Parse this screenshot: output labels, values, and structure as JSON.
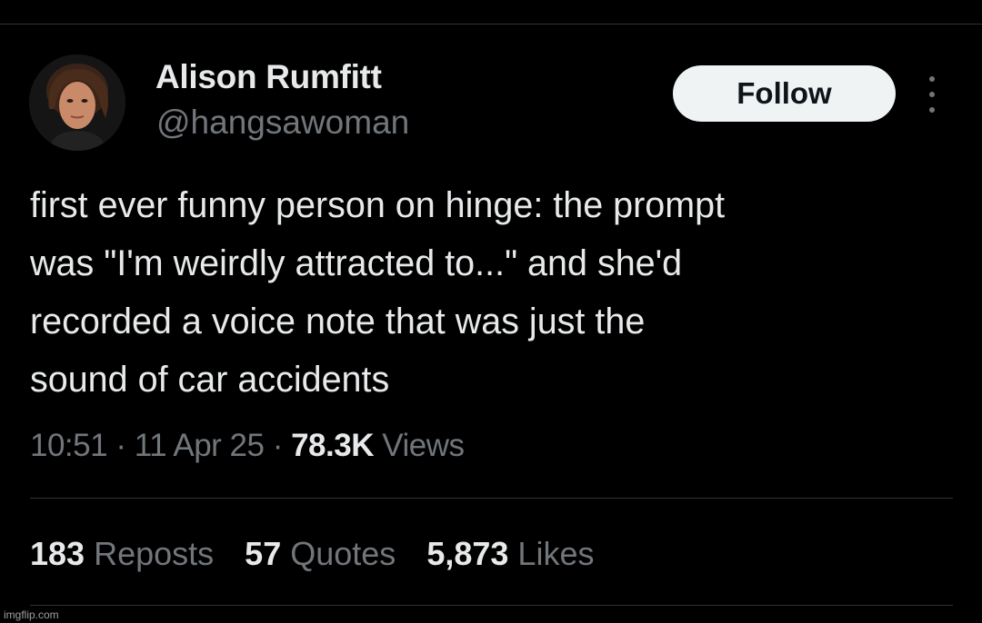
{
  "colors": {
    "background": "#000000",
    "primary_text": "#e7e9ea",
    "secondary_text": "#71767b",
    "divider": "#2f3336",
    "follow_button_bg": "#eff3f4",
    "follow_button_text": "#0f1419"
  },
  "author": {
    "display_name": "Alison Rumfitt",
    "handle": "@hangsawoman",
    "avatar": "profile-photo"
  },
  "follow_button": {
    "label": "Follow"
  },
  "more_menu": {
    "icon": "more-vertical-icon"
  },
  "tweet": {
    "lines": [
      "first ever funny person on hinge: the prompt",
      "was \"I'm weirdly attracted to...\" and she'd",
      "recorded a voice note that was just the",
      "sound of car accidents"
    ]
  },
  "meta": {
    "time": "10:51",
    "separator": "·",
    "date": "11 Apr 25",
    "views_count": "78.3K",
    "views_label": "Views"
  },
  "stats": {
    "reposts_count": "183",
    "reposts_label": "Reposts",
    "quotes_count": "57",
    "quotes_label": "Quotes",
    "likes_count": "5,873",
    "likes_label": "Likes"
  },
  "watermark": "imgflip.com"
}
